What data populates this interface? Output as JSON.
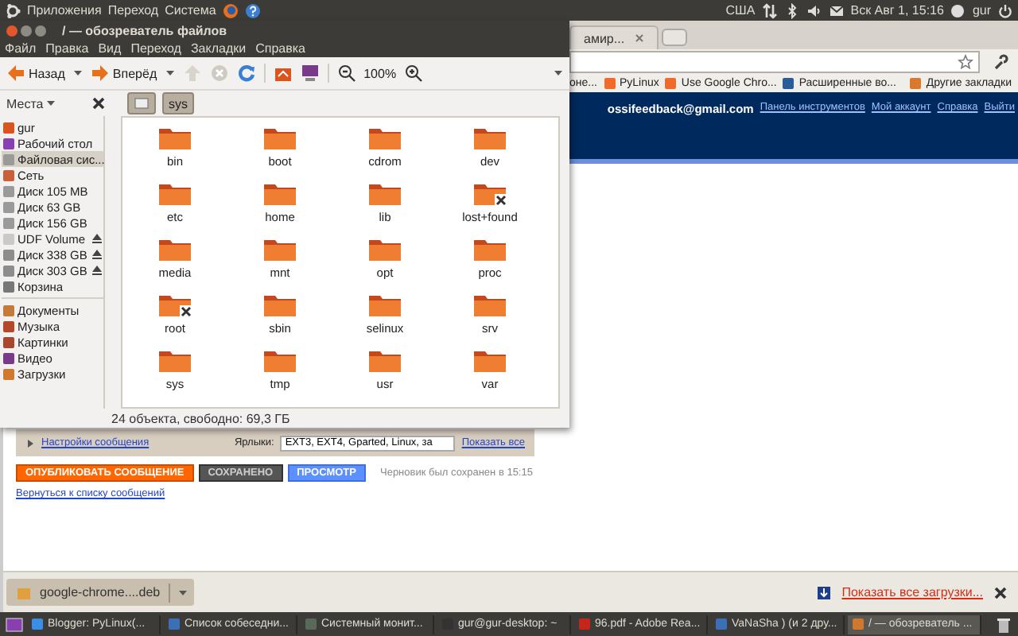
{
  "top_panel": {
    "menus": [
      "Приложения",
      "Переход",
      "Система"
    ],
    "keyboard": "США",
    "clock": "Вск Авг  1, 15:16",
    "user": "gur"
  },
  "browser": {
    "tabs": [
      {
        "label": "амир...",
        "selected": false
      }
    ],
    "bookmarks": [
      {
        "label": "оне...",
        "kind": "plain"
      },
      {
        "label": "PyLinux",
        "kind": "blogger"
      },
      {
        "label": "Use Google Chro...",
        "kind": "blogger"
      },
      {
        "label": "Расширенные во...",
        "kind": "site"
      }
    ],
    "other_bookmarks": "Другие закладки",
    "account": {
      "email": "ossifeedback@gmail.com",
      "links": [
        "Панель инструментов",
        "Мой аккаунт",
        "Справка",
        "Выйти"
      ]
    },
    "post_settings": "Настройки сообщения",
    "labels_caption": "Ярлыки:",
    "labels_value": "EXT3, EXT4, Gparted, Linux, за",
    "show_all": "Показать все",
    "buttons": [
      {
        "label": "ОПУБЛИКОВАТЬ СООБЩЕНИЕ",
        "kind": "publish"
      },
      {
        "label": "СОХРАНЕНО",
        "kind": "saved"
      },
      {
        "label": "ПРОСМОТР",
        "kind": "preview"
      }
    ],
    "draft_note": "Черновик был сохранен в 15:15",
    "back_link": "Вернуться к списку сообщений",
    "download": {
      "file": "google-chrome....deb",
      "show_all": "Показать все загрузки..."
    }
  },
  "file_manager": {
    "title": "/ — обозреватель файлов",
    "menu": [
      "Файл",
      "Правка",
      "Вид",
      "Переход",
      "Закладки",
      "Справка"
    ],
    "back": "Назад",
    "forward": "Вперёд",
    "zoom": "100%",
    "places": "Места",
    "location": "sys",
    "sidebar": [
      {
        "items": [
          {
            "label": "gur",
            "kind": "home",
            "eject": false,
            "selected": false
          },
          {
            "label": "Рабочий стол",
            "kind": "desktop",
            "eject": false,
            "selected": false
          },
          {
            "label": "Файловая сис...",
            "kind": "drive",
            "eject": false,
            "selected": true
          },
          {
            "label": "Сеть",
            "kind": "network",
            "eject": false,
            "selected": false
          },
          {
            "label": "Диск 105 MB",
            "kind": "drive",
            "eject": false,
            "selected": false
          },
          {
            "label": "Диск 63 GB",
            "kind": "drive",
            "eject": false,
            "selected": false
          },
          {
            "label": "Диск 156 GB",
            "kind": "drive",
            "eject": false,
            "selected": false
          },
          {
            "label": "UDF Volume",
            "kind": "disc",
            "eject": true,
            "selected": false
          },
          {
            "label": "Диск 338 GB",
            "kind": "usb",
            "eject": true,
            "selected": false
          },
          {
            "label": "Диск 303 GB",
            "kind": "usb",
            "eject": true,
            "selected": false
          },
          {
            "label": "Корзина",
            "kind": "trash",
            "eject": false,
            "selected": false
          }
        ]
      },
      {
        "items": [
          {
            "label": "Документы",
            "kind": "folder",
            "eject": false,
            "selected": false
          },
          {
            "label": "Музыка",
            "kind": "music",
            "eject": false,
            "selected": false
          },
          {
            "label": "Картинки",
            "kind": "pictures",
            "eject": false,
            "selected": false
          },
          {
            "label": "Видео",
            "kind": "video",
            "eject": false,
            "selected": false
          },
          {
            "label": "Загрузки",
            "kind": "downloads",
            "eject": false,
            "selected": false
          }
        ]
      }
    ],
    "files": [
      {
        "name": "bin",
        "locked": false
      },
      {
        "name": "boot",
        "locked": false
      },
      {
        "name": "cdrom",
        "locked": false
      },
      {
        "name": "dev",
        "locked": false
      },
      {
        "name": "etc",
        "locked": false
      },
      {
        "name": "home",
        "locked": false
      },
      {
        "name": "lib",
        "locked": false
      },
      {
        "name": "lost+found",
        "locked": true
      },
      {
        "name": "media",
        "locked": false
      },
      {
        "name": "mnt",
        "locked": false
      },
      {
        "name": "opt",
        "locked": false
      },
      {
        "name": "proc",
        "locked": false
      },
      {
        "name": "root",
        "locked": true
      },
      {
        "name": "sbin",
        "locked": false
      },
      {
        "name": "selinux",
        "locked": false
      },
      {
        "name": "srv",
        "locked": false
      },
      {
        "name": "sys",
        "locked": false
      },
      {
        "name": "tmp",
        "locked": false
      },
      {
        "name": "usr",
        "locked": false
      },
      {
        "name": "var",
        "locked": false
      }
    ],
    "status": "24 объекта, свободно: 69,3 ГБ"
  },
  "taskbar": [
    {
      "label": "Blogger: PyLinux(...",
      "kind": "browser",
      "selected": false
    },
    {
      "label": "Список собеседни...",
      "kind": "chat",
      "selected": false
    },
    {
      "label": "Системный монит...",
      "kind": "monitor",
      "selected": false
    },
    {
      "label": "gur@gur-desktop: ~",
      "kind": "terminal",
      "selected": false
    },
    {
      "label": "96.pdf - Adobe Rea...",
      "kind": "pdf",
      "selected": false
    },
    {
      "label": "VaNaSha ) (и 2 дру...",
      "kind": "chat",
      "selected": false
    },
    {
      "label": "/ — обозреватель ...",
      "kind": "files",
      "selected": true
    }
  ]
}
